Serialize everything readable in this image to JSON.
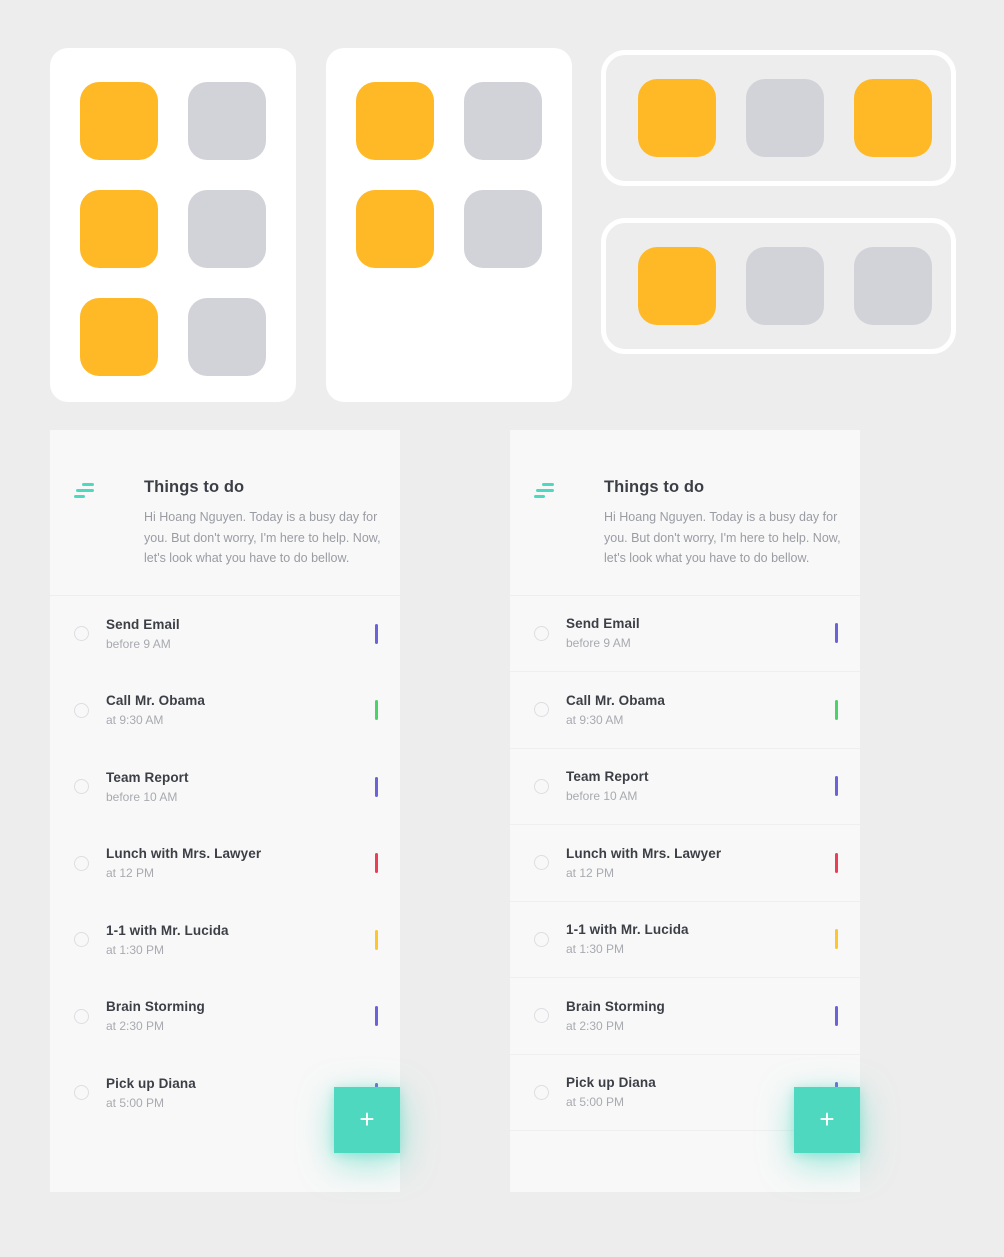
{
  "background_color": "#ededed",
  "showcase": {
    "palette": {
      "orange": "#ffb927",
      "grey": "#d2d2d9",
      "white": "#ffffff"
    },
    "cards": [
      {
        "name": "grid-card-3-rows",
        "layout": "2x3",
        "tiles": [
          "orange",
          "grey",
          "orange",
          "grey",
          "orange",
          "grey"
        ]
      },
      {
        "name": "grid-card-2-rows",
        "layout": "2x2",
        "tiles": [
          "orange",
          "grey",
          "orange",
          "grey"
        ]
      }
    ],
    "outline_rows": [
      {
        "name": "outline-row-1",
        "tiles": [
          "orange",
          "grey",
          "orange"
        ]
      },
      {
        "name": "outline-row-2",
        "tiles": [
          "orange",
          "grey",
          "grey"
        ]
      }
    ]
  },
  "panel": {
    "icon": "sort-icon",
    "icon_color": "#4fd8c0",
    "title": "Things to do",
    "subtitle": "Hi Hoang Nguyen. Today is a busy day for you. But don't worry, I'm here to help. Now, let's look what you have to do bellow.",
    "fab_label": "+",
    "fab_color": "#4fd8c0",
    "tasks": [
      {
        "name": "Send Email",
        "time": "before 9 AM",
        "marker_color": "#6c63d8"
      },
      {
        "name": "Call Mr. Obama",
        "time": "at 9:30 AM",
        "marker_color": "#4cd268"
      },
      {
        "name": "Team Report",
        "time": "before 10 AM",
        "marker_color": "#6c63d8"
      },
      {
        "name": "Lunch with Mrs. Lawyer",
        "time": "at 12 PM",
        "marker_color": "#ee3d56"
      },
      {
        "name": "1-1 with Mr. Lucida",
        "time": "at 1:30 PM",
        "marker_color": "#fdc72b"
      },
      {
        "name": "Brain Storming",
        "time": "at 2:30 PM",
        "marker_color": "#6c63d8"
      },
      {
        "name": "Pick up Diana",
        "time": "at 5:00 PM",
        "marker_color": "#6c63d8"
      }
    ]
  },
  "panels": [
    {
      "variant": "no-dividers"
    },
    {
      "variant": "with-dividers"
    }
  ]
}
